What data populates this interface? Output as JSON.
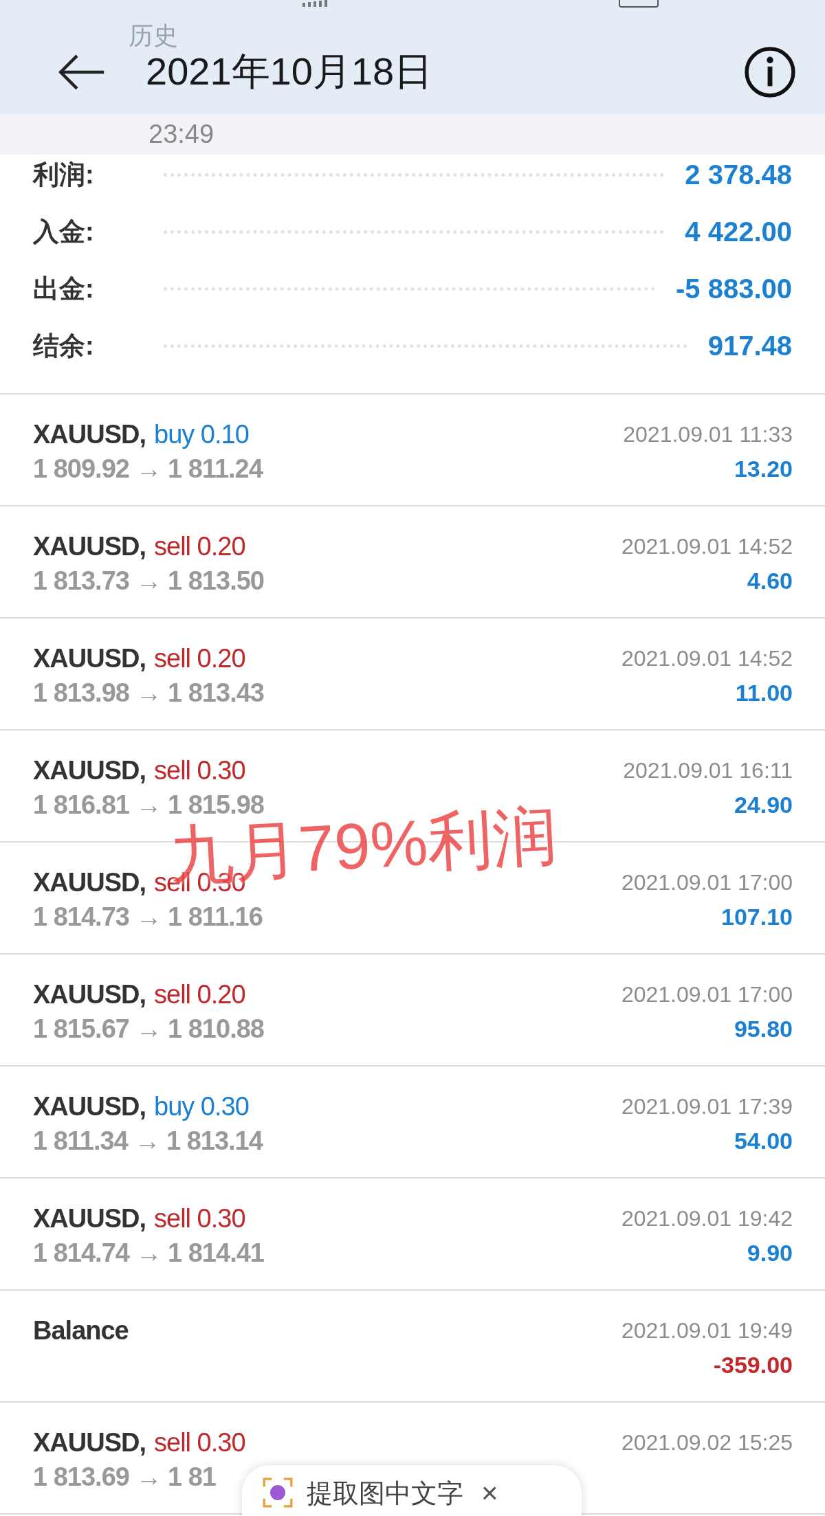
{
  "header": {
    "ghost_title": "历史",
    "title": "2021年10月18日",
    "subtitle": "23:49"
  },
  "summary": [
    {
      "label": "利润:",
      "value": "2 378.48"
    },
    {
      "label": "入金:",
      "value": "4 422.00"
    },
    {
      "label": "出金:",
      "value": "-5 883.00"
    },
    {
      "label": "结余:",
      "value": "917.48"
    }
  ],
  "trades": [
    {
      "kind": "trade",
      "symbol": "XAUUSD,",
      "color": "#1b7fd2",
      "order": "buy 0.10",
      "prices": "1 809.92 → 1 811.24",
      "time": "2021.09.01 11:33",
      "profit": "13.20",
      "negative": false
    },
    {
      "kind": "trade",
      "symbol": "XAUUSD,",
      "color": "#c0282b",
      "order": "sell 0.20",
      "prices": "1 813.73 → 1 813.50",
      "time": "2021.09.01 14:52",
      "profit": "4.60",
      "negative": false
    },
    {
      "kind": "trade",
      "symbol": "XAUUSD,",
      "color": "#c0282b",
      "order": "sell 0.20",
      "prices": "1 813.98 → 1 813.43",
      "time": "2021.09.01 14:52",
      "profit": "11.00",
      "negative": false
    },
    {
      "kind": "trade",
      "symbol": "XAUUSD,",
      "color": "#c0282b",
      "order": "sell 0.30",
      "prices": "1 816.81 → 1 815.98",
      "time": "2021.09.01 16:11",
      "profit": "24.90",
      "negative": false
    },
    {
      "kind": "trade",
      "symbol": "XAUUSD,",
      "color": "#c0282b",
      "order": "sell 0.30",
      "prices": "1 814.73 → 1 811.16",
      "time": "2021.09.01 17:00",
      "profit": "107.10",
      "negative": false
    },
    {
      "kind": "trade",
      "symbol": "XAUUSD,",
      "color": "#c0282b",
      "order": "sell 0.20",
      "prices": "1 815.67 → 1 810.88",
      "time": "2021.09.01 17:00",
      "profit": "95.80",
      "negative": false
    },
    {
      "kind": "trade",
      "symbol": "XAUUSD,",
      "color": "#1b7fd2",
      "order": "buy 0.30",
      "prices": "1 811.34 → 1 813.14",
      "time": "2021.09.01 17:39",
      "profit": "54.00",
      "negative": false
    },
    {
      "kind": "trade",
      "symbol": "XAUUSD,",
      "color": "#c0282b",
      "order": "sell 0.30",
      "prices": "1 814.74 → 1 814.41",
      "time": "2021.09.01 19:42",
      "profit": "9.90",
      "negative": false
    },
    {
      "kind": "balance",
      "symbol": "Balance",
      "time": "2021.09.01 19:49",
      "profit": "-359.00",
      "negative": true
    },
    {
      "kind": "trade",
      "symbol": "XAUUSD,",
      "color": "#c0282b",
      "order": "sell 0.30",
      "prices": "1 813.69 → 1 81",
      "time": "2021.09.02 15:25"
    }
  ],
  "annotation": "九月79%利润",
  "popup": {
    "text": "提取图中文字",
    "close": "×"
  }
}
